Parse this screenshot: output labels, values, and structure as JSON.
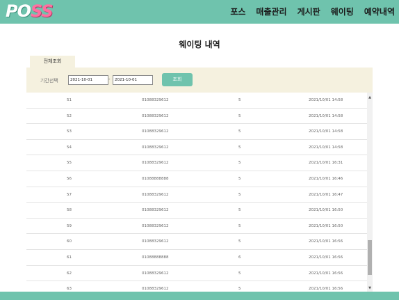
{
  "header": {
    "logo_part1": "PO",
    "logo_part2": "SS",
    "nav": [
      "포스",
      "매출관리",
      "게시판",
      "웨이팅",
      "예약내역"
    ]
  },
  "page_title": "웨이팅 내역",
  "tab_label": "전체조회",
  "filter": {
    "label": "기간선택",
    "date_from": "2021-10-01",
    "separator": "-",
    "date_to": "2021-10-01",
    "search_label": "조회"
  },
  "rows": [
    {
      "num": "51",
      "phone": "01088329612",
      "val": "5",
      "date": "2021/10/01 14:58"
    },
    {
      "num": "52",
      "phone": "01088329612",
      "val": "5",
      "date": "2021/10/01 14:58"
    },
    {
      "num": "53",
      "phone": "01088329612",
      "val": "5",
      "date": "2021/10/01 14:58"
    },
    {
      "num": "54",
      "phone": "01088329612",
      "val": "5",
      "date": "2021/10/01 14:58"
    },
    {
      "num": "55",
      "phone": "01088329612",
      "val": "5",
      "date": "2021/10/01 16:31"
    },
    {
      "num": "56",
      "phone": "01088888888",
      "val": "5",
      "date": "2021/10/01 16:46"
    },
    {
      "num": "57",
      "phone": "01088329612",
      "val": "5",
      "date": "2021/10/01 16:47"
    },
    {
      "num": "58",
      "phone": "01088329612",
      "val": "5",
      "date": "2021/10/01 16:50"
    },
    {
      "num": "59",
      "phone": "01088329612",
      "val": "5",
      "date": "2021/10/01 16:50"
    },
    {
      "num": "60",
      "phone": "01088329612",
      "val": "5",
      "date": "2021/10/01 16:56"
    },
    {
      "num": "61",
      "phone": "01088888888",
      "val": "6",
      "date": "2021/10/01 16:56"
    },
    {
      "num": "62",
      "phone": "01088329612",
      "val": "5",
      "date": "2021/10/01 16:56"
    },
    {
      "num": "63",
      "phone": "01088329612",
      "val": "5",
      "date": "2021/10/01 16:56"
    }
  ],
  "scroll": {
    "up_icon": "▲",
    "down_icon": "▼"
  },
  "colors": {
    "brand": "#6fc3ad",
    "panel": "#f5f1df",
    "logo_accent": "#ff6fa0"
  }
}
